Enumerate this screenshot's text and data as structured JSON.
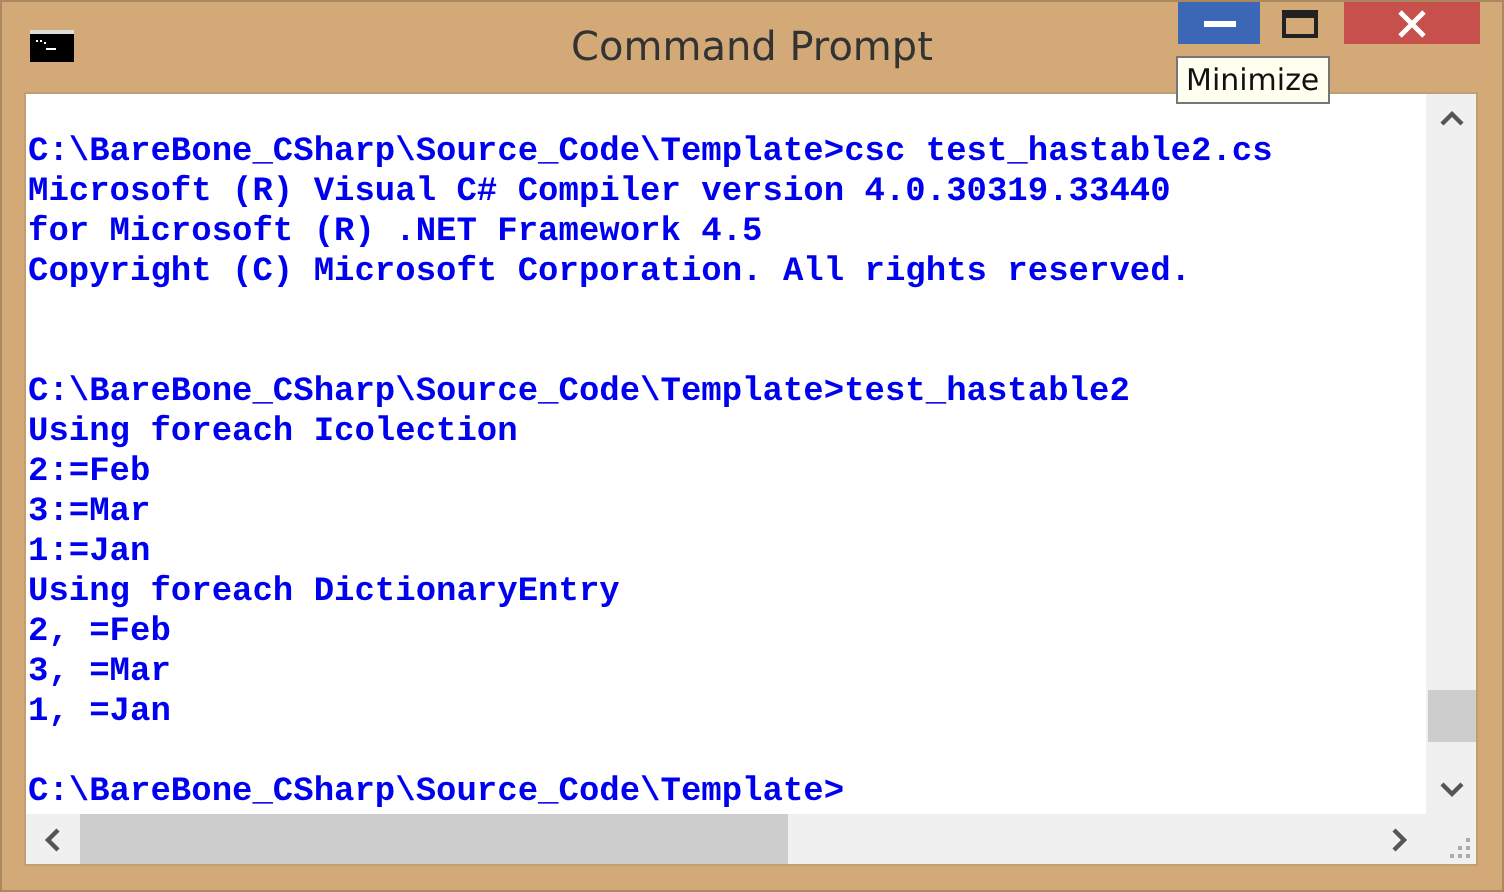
{
  "window": {
    "title": "Command Prompt",
    "controls": [
      {
        "kind": "minimize",
        "hovered": true
      },
      {
        "kind": "maximize",
        "hovered": false
      },
      {
        "kind": "close",
        "hovered": false
      }
    ],
    "tooltip": "Minimize"
  },
  "console": {
    "lines": [
      {
        "kind": "blank"
      },
      {
        "kind": "text",
        "text": "C:\\BareBone_CSharp\\Source_Code\\Template>csc test_hastable2.cs"
      },
      {
        "kind": "text",
        "text": "Microsoft (R) Visual C# Compiler version 4.0.30319.33440"
      },
      {
        "kind": "text",
        "text": "for Microsoft (R) .NET Framework 4.5"
      },
      {
        "kind": "text",
        "text": "Copyright (C) Microsoft Corporation. All rights reserved."
      },
      {
        "kind": "blank"
      },
      {
        "kind": "blank"
      },
      {
        "kind": "text",
        "text": "C:\\BareBone_CSharp\\Source_Code\\Template>test_hastable2"
      },
      {
        "kind": "text",
        "text": "Using foreach Icolection"
      },
      {
        "kind": "text",
        "text": "2:=Feb"
      },
      {
        "kind": "text",
        "text": "3:=Mar"
      },
      {
        "kind": "text",
        "text": "1:=Jan"
      },
      {
        "kind": "text",
        "text": "Using foreach DictionaryEntry"
      },
      {
        "kind": "text",
        "text": "2, =Feb"
      },
      {
        "kind": "text",
        "text": "3, =Mar"
      },
      {
        "kind": "text",
        "text": "1, =Jan"
      },
      {
        "kind": "blank"
      },
      {
        "kind": "text",
        "text": "C:\\BareBone_CSharp\\Source_Code\\Template>"
      }
    ]
  }
}
